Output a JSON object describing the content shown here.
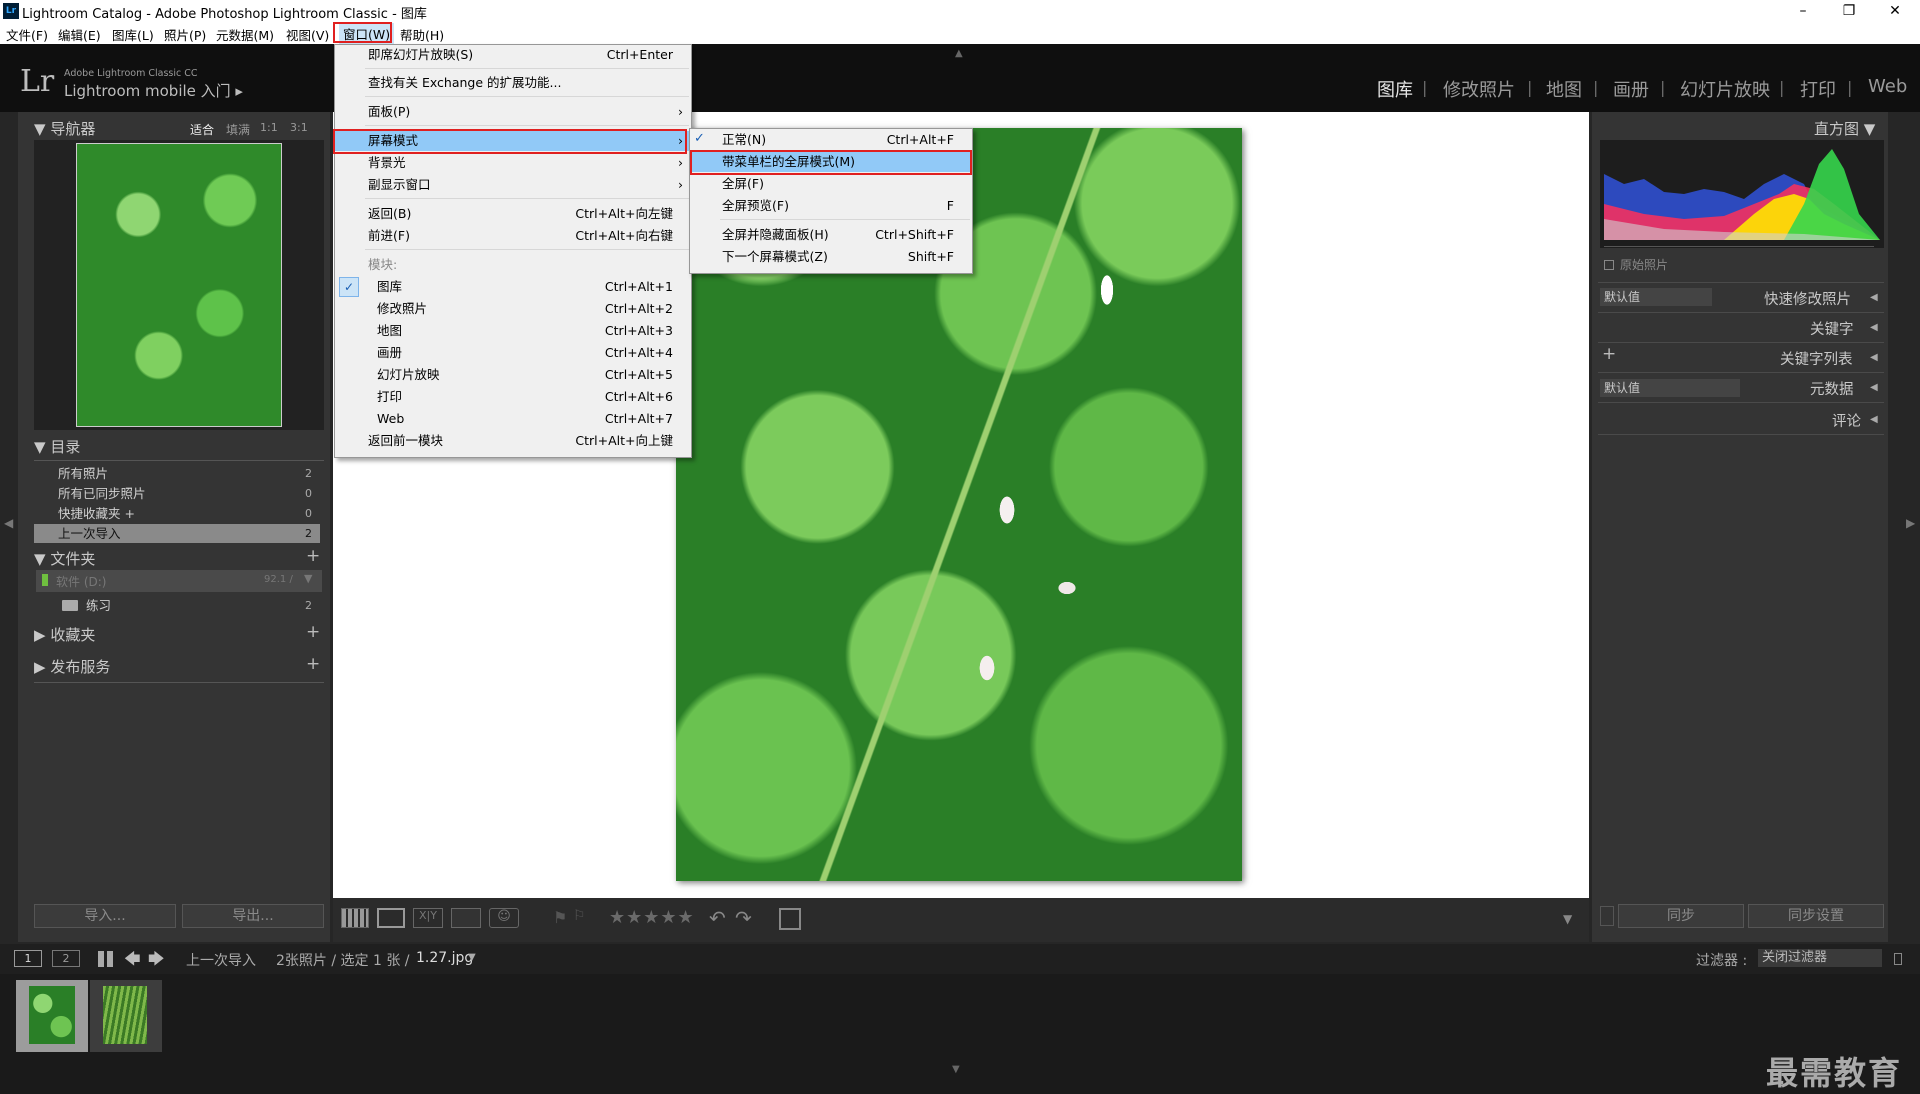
{
  "window": {
    "title": "Lightroom Catalog - Adobe Photoshop Lightroom Classic - 图库",
    "app_badge": "Lr",
    "controls": [
      "–",
      "❐",
      "✕"
    ]
  },
  "menubar": {
    "items": [
      "文件(F)",
      "编辑(E)",
      "图库(L)",
      "照片(P)",
      "元数据(M)",
      "视图(V)",
      "窗口(W)",
      "帮助(H)"
    ]
  },
  "identity": {
    "brand": "Adobe Lightroom Classic CC",
    "logo": "Lr",
    "mobile": "Lightroom mobile 入门 ▸"
  },
  "modules": [
    "图库",
    "修改照片",
    "地图",
    "画册",
    "幻灯片放映",
    "打印",
    "Web"
  ],
  "navigator": {
    "title": "导航器",
    "zoom": [
      "适合",
      "填满",
      "1:1",
      "3:1"
    ]
  },
  "catalog": {
    "title": "目录",
    "items": [
      {
        "label": "所有照片",
        "count": "2"
      },
      {
        "label": "所有已同步照片",
        "count": "0"
      },
      {
        "label": "快捷收藏夹 +",
        "count": "0"
      },
      {
        "label": "上一次导入",
        "count": "2"
      }
    ]
  },
  "folders": {
    "title": "文件夹",
    "volume": "软件 (D:)",
    "volume_size": "92.1 /",
    "items": [
      {
        "label": "练习",
        "count": "2"
      }
    ]
  },
  "collections": {
    "title": "收藏夹"
  },
  "publish": {
    "title": "发布服务"
  },
  "left_buttons": {
    "import": "导入...",
    "export": "导出..."
  },
  "right": {
    "histogram": "直方图",
    "original": "原始照片",
    "preset_default": "默认值",
    "quick_develop": "快速修改照片",
    "keywording": "关键字",
    "keyword_list": "关键字列表",
    "metadata_default": "默认值",
    "metadata": "元数据",
    "comments": "评论",
    "sync": "同步",
    "sync_settings": "同步设置"
  },
  "filmstrip": {
    "pages": [
      "1",
      "2"
    ],
    "source": "上一次导入",
    "info": "2张照片 / 选定 1 张 /",
    "file": "1.27.jpg",
    "filter_label": "过滤器 :",
    "filter_value": "关闭过滤器"
  },
  "window_menu": {
    "items": [
      {
        "label": "即席幻灯片放映(S)",
        "shortcut": "Ctrl+Enter"
      },
      {
        "label": "查找有关 Exchange 的扩展功能...",
        "shortcut": ""
      },
      {
        "label": "面板(P)",
        "shortcut": ""
      },
      {
        "label": "屏幕模式",
        "shortcut": ""
      },
      {
        "label": "背景光",
        "shortcut": ""
      },
      {
        "label": "副显示窗口",
        "shortcut": ""
      },
      {
        "label": "返回(B)",
        "shortcut": "Ctrl+Alt+向左键"
      },
      {
        "label": "前进(F)",
        "shortcut": "Ctrl+Alt+向右键"
      },
      {
        "label": "模块:",
        "shortcut": ""
      },
      {
        "label": "图库",
        "shortcut": "Ctrl+Alt+1"
      },
      {
        "label": "修改照片",
        "shortcut": "Ctrl+Alt+2"
      },
      {
        "label": "地图",
        "shortcut": "Ctrl+Alt+3"
      },
      {
        "label": "画册",
        "shortcut": "Ctrl+Alt+4"
      },
      {
        "label": "幻灯片放映",
        "shortcut": "Ctrl+Alt+5"
      },
      {
        "label": "打印",
        "shortcut": "Ctrl+Alt+6"
      },
      {
        "label": "Web",
        "shortcut": "Ctrl+Alt+7"
      },
      {
        "label": "返回前一模块",
        "shortcut": "Ctrl+Alt+向上键"
      }
    ]
  },
  "screen_mode_menu": {
    "items": [
      {
        "label": "正常(N)",
        "shortcut": "Ctrl+Alt+F"
      },
      {
        "label": "带菜单栏的全屏模式(M)",
        "shortcut": ""
      },
      {
        "label": "全屏(F)",
        "shortcut": ""
      },
      {
        "label": "全屏预览(F)",
        "shortcut": "F"
      },
      {
        "label": "全屏并隐藏面板(H)",
        "shortcut": "Ctrl+Shift+F"
      },
      {
        "label": "下一个屏幕模式(Z)",
        "shortcut": "Shift+F"
      }
    ]
  },
  "watermark": "最需教育",
  "colors": {
    "highlight": "#91c9f7",
    "red_box": "#e02020",
    "panel": "#343434"
  }
}
